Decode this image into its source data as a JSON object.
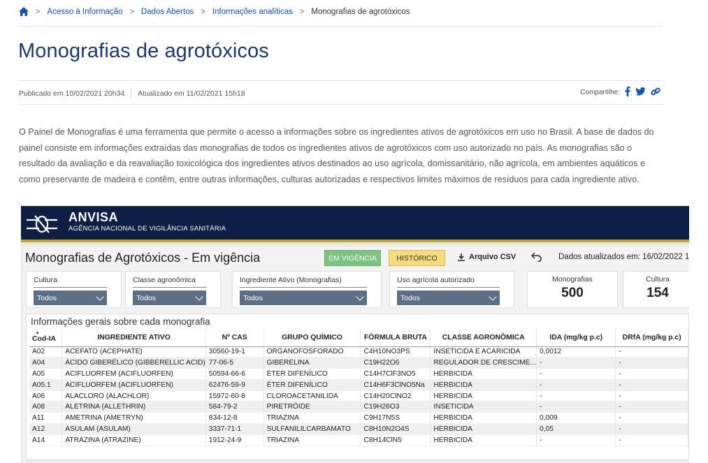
{
  "breadcrumb": {
    "items": [
      "Acesso à Informação",
      "Dados Abertos",
      "Informações analíticas"
    ],
    "current": "Monografias de agrotóxicos"
  },
  "page": {
    "title": "Monografias de agrotóxicos",
    "published": "Publicado em 10/02/2021 20h34",
    "updated": "Atualizado em 11/02/2021 15h18",
    "share_label": "Compartilhe:",
    "intro": "O Painel de Monografias é uma ferramenta que permite o acesso a informações sobre os ingredientes ativos de agrotóxicos em uso no Brasil. A base de dados do painel consiste em informações extraídas das monografias de todos os ingredientes ativos de agrotóxicos com uso autorizado no país. As monografias são o resultado da avaliação e da reavaliação toxicológica dos ingredientes ativos destinados ao uso agrícola, domissanitário, não agrícola, em ambientes aquáticos e como preservante de madeira e contêm, entre outras informações, culturas autorizadas e respectivos limites máximos de resíduos para cada ingrediente ativo."
  },
  "dashboard": {
    "brand": "ANVISA",
    "brand_sub": "AGÊNCIA NACIONAL DE VIGILÂNCIA SANITÁRIA",
    "title": "Monografias de Agrotóxicos - Em vigência",
    "btn_vigencia": "EM VIGÊNCIA",
    "btn_historico": "HISTÓRICO",
    "csv_label": "Arquivo CSV",
    "updated_text": "Dados atualizados em: 16/02/2022 1",
    "filters": [
      {
        "label": "Cultura",
        "value": "Todos"
      },
      {
        "label": "Classe agronômica",
        "value": "Todos"
      },
      {
        "label": "Ingrediente Ativo (Monografias)",
        "value": "Todos"
      },
      {
        "label": "Uso agrícola autorizado",
        "value": "Todos"
      }
    ],
    "cards": [
      {
        "label": "Monografias",
        "value": "500"
      },
      {
        "label": "Cultura",
        "value": "154"
      }
    ],
    "table_title": "Informações gerais sobre cada monografia",
    "columns": [
      "Cod-IA",
      "INGREDIENTE ATIVO",
      "Nº CAS",
      "GRUPO QUÍMICO",
      "FÓRMULA BRUTA",
      "CLASSE AGRONÔMICA",
      "IDA (mg/kg p.c)",
      "DRfA (mg/kg p.c)"
    ],
    "rows": [
      [
        "A02",
        "ACEFATO (ACEPHATE)",
        "30560-19-1",
        "ORGANOFOSFORADO",
        "C4H10NO3PS",
        "INSETICIDA E ACARICIDA",
        "0,0012",
        "-"
      ],
      [
        "A04",
        "ÁCIDO GIBERÉLICO (GIBBERELLIC ACID)",
        "77-06-5",
        "GIBERELINA",
        "C19H22O6",
        "REGULADOR DE CRESCIME...",
        "-",
        "-"
      ],
      [
        "A05",
        "ACIFLUORFEM (ACIFLUORFEN)",
        "50594-66-6",
        "ÉTER DIFENÍLICO",
        "C14H7ClF3NO5",
        "HERBICIDA",
        "-",
        "-"
      ],
      [
        "A05.1",
        "ACIFLUORFEM (ACIFLUORFEN)",
        "62476-59-9",
        "ÉTER DIFENÍLICO",
        "C14H6F3ClNO5Na",
        "HERBICIDA",
        "-",
        "-"
      ],
      [
        "A06",
        "ALACLORO (ALACHLOR)",
        "15972-60-8",
        "CLOROACETANILIDA",
        "C14H20ClNO2",
        "HERBICIDA",
        "-",
        "-"
      ],
      [
        "A08",
        "ALETRINA (ALLETHRIN)",
        "584-79-2",
        "PIRETRÓIDE",
        "C19H26O3",
        "INSETICIDA",
        "-",
        "-"
      ],
      [
        "A11",
        "AMETRINA (AMETRYN)",
        "834-12-8",
        "TRIAZINA",
        "C9H17N5S",
        "HERBICIDA",
        "0,009",
        "-"
      ],
      [
        "A12",
        "ASULAM (ASULAM)",
        "3337-71-1",
        "SULFANILILCARBAMATO",
        "C8H10N2O4S",
        "HERBICIDA",
        "0,05",
        "-"
      ],
      [
        "A14",
        "ATRAZINA (ATRAZINE)",
        "1912-24-9",
        "TRIAZINA",
        "C8H14ClN5",
        "HERBICIDA",
        "-",
        "-"
      ]
    ]
  }
}
